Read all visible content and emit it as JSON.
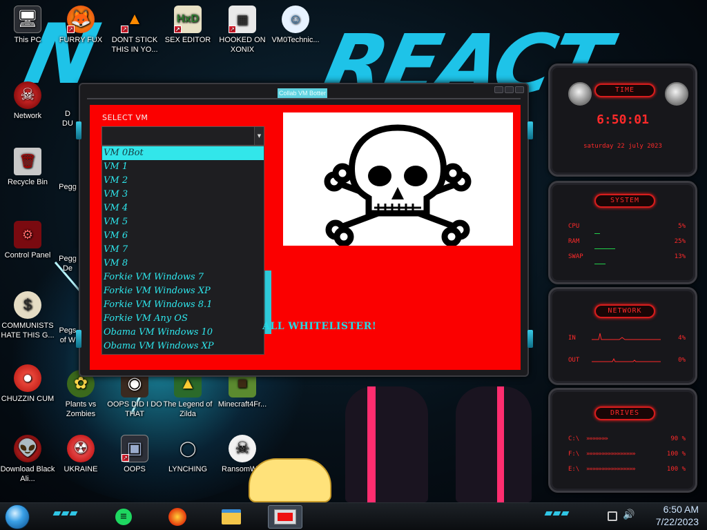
{
  "window": {
    "title": "Collab VM Botter",
    "select_label": "SELECT VM",
    "selected_vm": "",
    "vm_options": [
      "VM 0Bot",
      "VM 1",
      "VM 2",
      "VM 3",
      "VM 4",
      "VM 5",
      "VM 6",
      "VM 7",
      "VM 8",
      "Forkie VM Windows 7",
      "Forkie VM Windows XP",
      "Forkie VM Windows 8.1",
      "Forkie VM Any OS",
      "Obama VM Windows 10",
      "Obama VM Windows XP"
    ],
    "highlighted_index": 0,
    "whitelister_text": "ALL WHITELISTER!",
    "skull_icon": "skull-crossbones-icon"
  },
  "desktop": {
    "icons": [
      {
        "label": "This PC",
        "icon": "computer-icon"
      },
      {
        "label": "FURRY FUX",
        "icon": "firefox-icon"
      },
      {
        "label": "DONT STICK THIS IN YO...",
        "icon": "vlc-cone-icon"
      },
      {
        "label": "SEX EDITOR",
        "icon": "hxd-editor-icon"
      },
      {
        "label": "HOOKED ON XONIX",
        "icon": "xonix-game-icon"
      },
      {
        "label": "VM0Technic...",
        "icon": "mascot-icon"
      },
      {
        "label": "Network",
        "icon": "network-globe-icon"
      },
      {
        "label": "Recycle Bin",
        "icon": "recycle-bin-icon"
      },
      {
        "label": "Control Panel",
        "icon": "control-panel-icon"
      },
      {
        "label": "COMMUNISTS HATE THIS G...",
        "icon": "money-bag-icon"
      },
      {
        "label": "CHUZZIN CUM",
        "icon": "chuzzle-icon"
      },
      {
        "label": "Plants vs Zombies",
        "icon": "plants-vs-zombies-icon"
      },
      {
        "label": "OOPS DID I DO THAT",
        "icon": "oops-icon"
      },
      {
        "label": "The Legend of Zilda",
        "icon": "zelda-icon"
      },
      {
        "label": "Minecraft4Fr...",
        "icon": "minecraft-icon"
      },
      {
        "label": "Download Black Ali...",
        "icon": "alienware-icon"
      },
      {
        "label": "UKRAINE",
        "icon": "radiation-icon"
      },
      {
        "label": "OOPS",
        "icon": "oops-window-icon"
      },
      {
        "label": "LYNCHING",
        "icon": "noose-icon"
      },
      {
        "label": "RansomW...",
        "icon": "ransomware-skull-icon"
      }
    ],
    "partial_labels": [
      "D",
      "DU",
      "Pegg",
      "Pegg",
      "De",
      "Pegs",
      "of W"
    ]
  },
  "widgets": {
    "time": {
      "title": "TIME",
      "clock": "6:50:01",
      "date": "saturday 22 july 2023"
    },
    "system": {
      "title": "SYSTEM",
      "rows": [
        {
          "label": "CPU",
          "value": "5%"
        },
        {
          "label": "RAM",
          "value": "25%"
        },
        {
          "label": "SWAP",
          "value": "13%"
        }
      ]
    },
    "network": {
      "title": "NETWORK",
      "rows": [
        {
          "label": "IN",
          "value": "4%"
        },
        {
          "label": "OUT",
          "value": "0%"
        }
      ]
    },
    "drives": {
      "title": "DRIVES",
      "rows": [
        {
          "label": "C:\\",
          "value": "90 %"
        },
        {
          "label": "F:\\",
          "value": "100 %"
        },
        {
          "label": "E:\\",
          "value": "100 %"
        }
      ]
    }
  },
  "taskbar": {
    "time": "6:50 AM",
    "date": "7/22/2023",
    "apps": [
      "spotify-icon",
      "firefox-icon",
      "file-explorer-icon",
      "active-app-icon"
    ],
    "tray": [
      "network-tray-icon",
      "volume-icon"
    ]
  },
  "colors": {
    "app_background": "#fb0000",
    "dropdown_text": "#2ee8ee",
    "widget_red": "#ff2a2a"
  }
}
